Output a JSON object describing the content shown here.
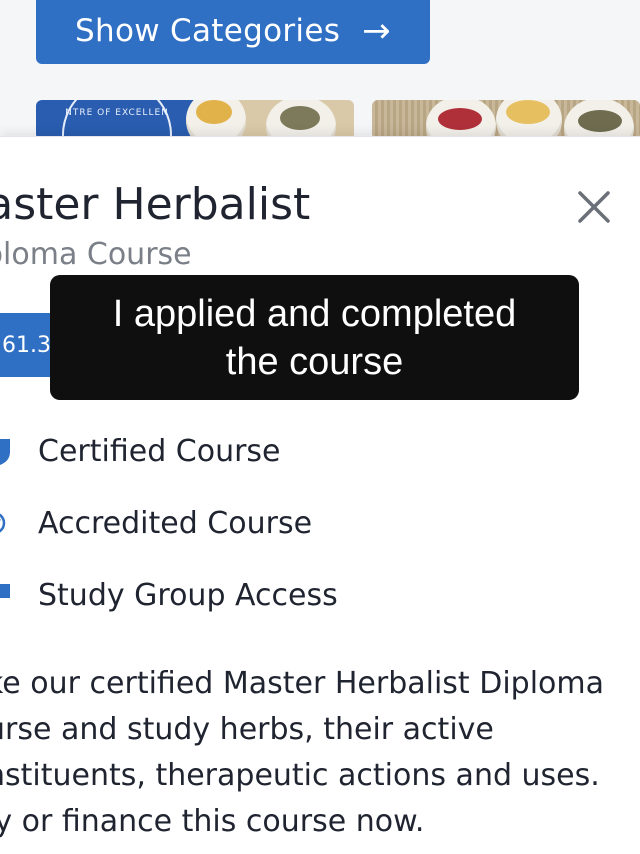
{
  "header": {
    "show_categories_label": "Show Categories",
    "arrow_glyph": "→"
  },
  "thumbnail": {
    "seal_text": "NTRE OF EXCELLEN"
  },
  "course": {
    "title": "laster Herbalist",
    "subtitle": "ploma Course",
    "price_partial": "61.3",
    "close_glyph": "✕"
  },
  "features": [
    {
      "label": "Certified Course",
      "icon": "shield-icon"
    },
    {
      "label": "Accredited Course",
      "icon": "check-circle-icon"
    },
    {
      "label": "Study Group Access",
      "icon": "chat-bubble-icon"
    }
  ],
  "description": {
    "line1": "ke our certified Master Herbalist Diploma",
    "line2": "urse and study herbs, their active",
    "line3": "nstituents, therapeutic actions and uses.",
    "line4": "ly or finance this course now."
  },
  "caption": {
    "line1": "I applied and completed",
    "line2": "the course"
  },
  "colors": {
    "brand_blue": "#2f6fc4",
    "caption_bg": "#0f0f10"
  }
}
